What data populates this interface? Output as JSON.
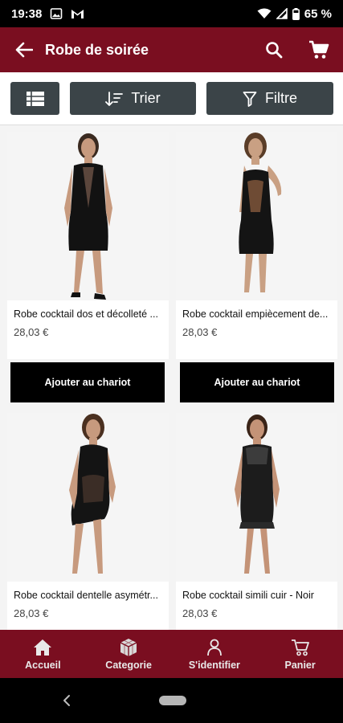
{
  "status_bar": {
    "time": "19:38",
    "battery": "65 %"
  },
  "app_bar": {
    "title": "Robe de soirée"
  },
  "toolbar": {
    "sort_label": "Trier",
    "filter_label": "Filtre"
  },
  "products": [
    {
      "name": "Robe cocktail dos et décolleté ...",
      "price": "28,03 €",
      "button": "Ajouter au chariot"
    },
    {
      "name": "Robe cocktail empiècement de...",
      "price": "28,03 €",
      "button": "Ajouter au chariot"
    },
    {
      "name": "Robe cocktail dentelle asymétr...",
      "price": "28,03 €"
    },
    {
      "name": "Robe cocktail simili cuir - Noir",
      "price": "28,03 €"
    }
  ],
  "bottom_nav": [
    {
      "label": "Accueil",
      "icon": "home-icon"
    },
    {
      "label": "Categorie",
      "icon": "cube-icon"
    },
    {
      "label": "S'identifier",
      "icon": "user-icon"
    },
    {
      "label": "Panier",
      "icon": "cart-icon"
    }
  ],
  "colors": {
    "brand": "#7a0e20",
    "toolbar_button": "#3b4448",
    "cta": "#000000"
  }
}
